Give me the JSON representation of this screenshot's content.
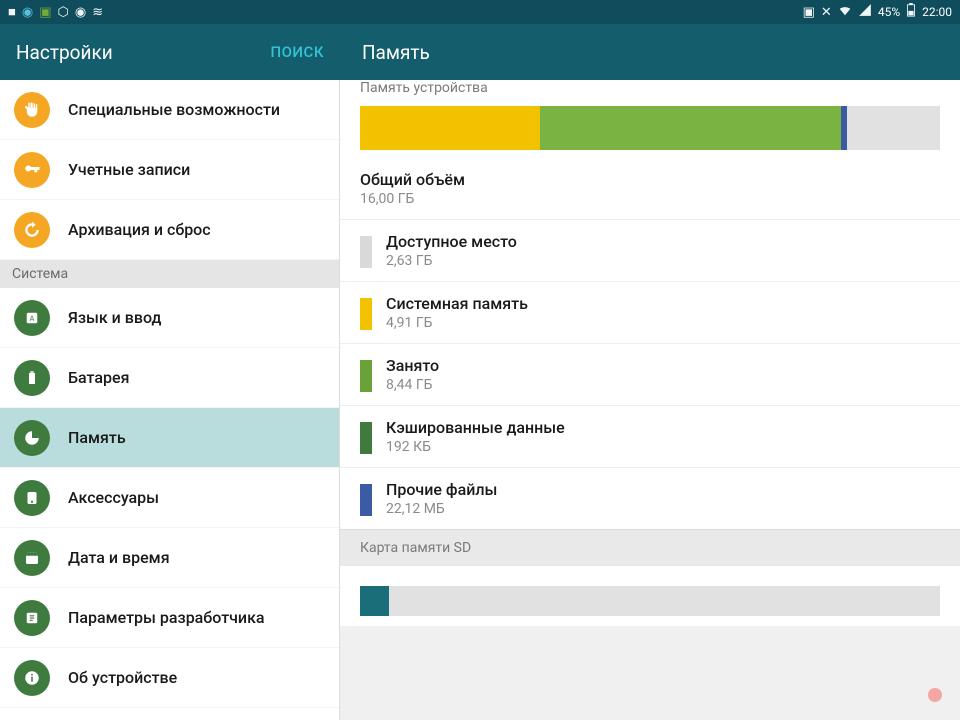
{
  "statusbar": {
    "battery_text": "45%",
    "time": "22:00"
  },
  "appbar": {
    "settings_title": "Настройки",
    "search_label": "ПОИСК",
    "detail_title": "Память"
  },
  "sidebar": {
    "items": [
      {
        "label": "Специальные возможности"
      },
      {
        "label": "Учетные записи"
      },
      {
        "label": "Архивация и сброс"
      }
    ],
    "system_header": "Система",
    "system_items": [
      {
        "label": "Язык и ввод"
      },
      {
        "label": "Батарея"
      },
      {
        "label": "Память"
      },
      {
        "label": "Аксессуары"
      },
      {
        "label": "Дата и время"
      },
      {
        "label": "Параметры разработчика"
      },
      {
        "label": "Об устройстве"
      }
    ]
  },
  "storage": {
    "device_header": "Память устройства",
    "segments": [
      {
        "color": "#f2c200",
        "pct": 31
      },
      {
        "color": "#7bb342",
        "pct": 52
      },
      {
        "color": "#3b5ba5",
        "pct": 1
      }
    ],
    "total": {
      "title": "Общий объём",
      "value": "16,00 ГБ"
    },
    "rows": [
      {
        "color": "#d9d9d9",
        "title": "Доступное место",
        "value": "2,63 ГБ"
      },
      {
        "color": "#f2c200",
        "title": "Системная память",
        "value": "4,91 ГБ"
      },
      {
        "color": "#6aa23a",
        "title": "Занято",
        "value": "8,44 ГБ"
      },
      {
        "color": "#3f7a3f",
        "title": "Кэшированные данные",
        "value": "192 КБ"
      },
      {
        "color": "#3b5ba5",
        "title": "Прочие файлы",
        "value": "22,12 МБ"
      }
    ],
    "sd_header": "Карта памяти SD",
    "sd_segments": [
      {
        "color": "#1a6e7a",
        "pct": 5
      }
    ]
  }
}
